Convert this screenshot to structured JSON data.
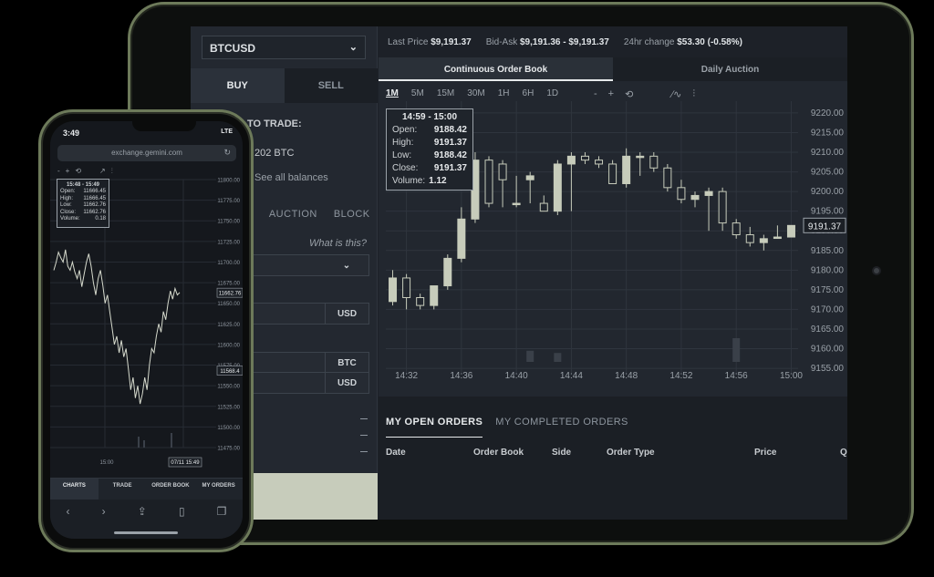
{
  "tablet": {
    "pair": "BTCUSD",
    "side_tabs": {
      "buy": "BUY",
      "sell": "SELL"
    },
    "trade_texts": {
      "title": "TO TRADE:",
      "balance": "202 BTC",
      "all_balances": "See all balances"
    },
    "order_types": [
      "S",
      "AUCTION",
      "BLOCK"
    ],
    "what_is_this": "What is this?",
    "fields": {
      "usd1": "USD",
      "btc": "BTC",
      "usd2": "USD"
    },
    "ticker": {
      "last_price_label": "Last Price",
      "last_price": "$9,191.37",
      "bid_ask_label": "Bid-Ask",
      "bid_ask": "$9,191.36 - $9,191.37",
      "change_label": "24hr change",
      "change": "$53.30 (-0.58%)"
    },
    "book_tabs": {
      "continuous": "Continuous Order Book",
      "auction": "Daily Auction"
    },
    "timeframes": [
      "1M",
      "5M",
      "15M",
      "30M",
      "1H",
      "6H",
      "1D"
    ],
    "chart_tools": [
      "-",
      "+",
      "⟲"
    ],
    "tooltip": {
      "range": "14:59 - 15:00",
      "rows": [
        {
          "label": "Open:",
          "value": "9188.42"
        },
        {
          "label": "High:",
          "value": "9191.37"
        },
        {
          "label": "Low:",
          "value": "9188.42"
        },
        {
          "label": "Close:",
          "value": "9191.37"
        },
        {
          "label": "Volume:",
          "value": "1.12"
        }
      ]
    },
    "orders_tabs": {
      "open": "MY OPEN ORDERS",
      "completed": "MY COMPLETED ORDERS"
    },
    "orders_columns": [
      "Date",
      "Order Book",
      "Side",
      "Order Type",
      "Price",
      "Q"
    ]
  },
  "chart_data": {
    "type": "candlestick",
    "title": "",
    "x": [
      "14:31",
      "14:32",
      "14:33",
      "14:34",
      "14:35",
      "14:36",
      "14:37",
      "14:38",
      "14:39",
      "14:40",
      "14:41",
      "14:42",
      "14:43",
      "14:44",
      "14:45",
      "14:46",
      "14:47",
      "14:48",
      "14:49",
      "14:50",
      "14:51",
      "14:52",
      "14:53",
      "14:54",
      "14:55",
      "14:56",
      "14:57",
      "14:58",
      "14:59",
      "15:00"
    ],
    "xticks": [
      "14:32",
      "14:36",
      "14:40",
      "14:44",
      "14:48",
      "14:52",
      "14:56",
      "15:00"
    ],
    "yticks": [
      "9220.00",
      "9215.00",
      "9210.00",
      "9205.00",
      "9200.00",
      "9195.00",
      "9190.00",
      "9185.00",
      "9180.00",
      "9175.00",
      "9170.00",
      "9165.00",
      "9160.00",
      "9155.00"
    ],
    "ylim": [
      9152,
      9223
    ],
    "current_price": "9191.37",
    "open": [
      9172,
      9178,
      9173,
      9171,
      9176,
      9183,
      9193,
      9208,
      9207,
      9197,
      9203,
      9197,
      9195,
      9207,
      9209,
      9208,
      9207,
      9202,
      9209,
      9209,
      9206,
      9201,
      9198,
      9199,
      9200,
      9192,
      9189,
      9187,
      9188.42,
      9188.42
    ],
    "high": [
      9180,
      9179,
      9174,
      9176,
      9184,
      9196,
      9210,
      9209,
      9208,
      9204,
      9205,
      9199,
      9208,
      9210,
      9210,
      9209,
      9208,
      9211,
      9210,
      9210,
      9207,
      9203,
      9200,
      9201,
      9201,
      9193,
      9191,
      9189,
      9191.37,
      9191.37
    ],
    "low": [
      9171,
      9170,
      9170,
      9170,
      9175,
      9182,
      9192,
      9196,
      9196,
      9196,
      9197,
      9195,
      9194,
      9195,
      9207,
      9206,
      9202,
      9201,
      9204,
      9205,
      9200,
      9197,
      9196,
      9190,
      9190,
      9188,
      9186,
      9185,
      9188.42,
      9188.42
    ],
    "close": [
      9178,
      9173,
      9171,
      9176,
      9183,
      9193,
      9208,
      9197,
      9203,
      9197,
      9204,
      9195,
      9207,
      9209,
      9208,
      9207,
      9202,
      9209,
      9209,
      9206,
      9201,
      9198,
      9199,
      9200,
      9192,
      9189,
      9187,
      9188,
      9188.42,
      9191.37
    ],
    "volume": [
      0,
      0,
      0,
      0,
      0,
      0,
      0,
      0,
      0,
      0,
      1.5,
      0,
      1.2,
      0,
      0,
      0,
      0,
      0,
      0,
      0,
      0,
      0,
      0,
      0,
      0,
      3.2,
      0,
      0,
      0,
      0
    ]
  },
  "phone": {
    "time": "3:49",
    "signal": "LTE",
    "url": "exchange.gemini.com",
    "tools": [
      "-",
      "+",
      "⟲",
      "↗",
      "⫶"
    ],
    "tooltip": {
      "range": "15:48 - 15:49",
      "rows": [
        {
          "label": "Open:",
          "value": "11666.45"
        },
        {
          "label": "High:",
          "value": "11666.45"
        },
        {
          "label": "Low:",
          "value": "11662.76"
        },
        {
          "label": "Close:",
          "value": "11662.76"
        },
        {
          "label": "Volume:",
          "value": "0.18"
        }
      ]
    },
    "yticks": [
      "11800.00",
      "11775.00",
      "11750.00",
      "11725.00",
      "11700.00",
      "11675.00",
      "11650.00",
      "11625.00",
      "11600.00",
      "11575.00",
      "11550.00",
      "11525.00",
      "11500.00",
      "11475.00"
    ],
    "price_tag": "11662.76",
    "price_tag2": "11568.4",
    "xticks": [
      "15:00",
      "07/11 15:49"
    ],
    "nav": [
      "CHARTS",
      "TRADE",
      "ORDER BOOK",
      "MY ORDERS"
    ],
    "bottom_icons": [
      "‹",
      "›",
      "⇪",
      "▯",
      "❐"
    ]
  },
  "colors": {
    "candle_up": "#c7ccbb",
    "candle_down": "#c7ccbb",
    "panel": "#22272f"
  }
}
